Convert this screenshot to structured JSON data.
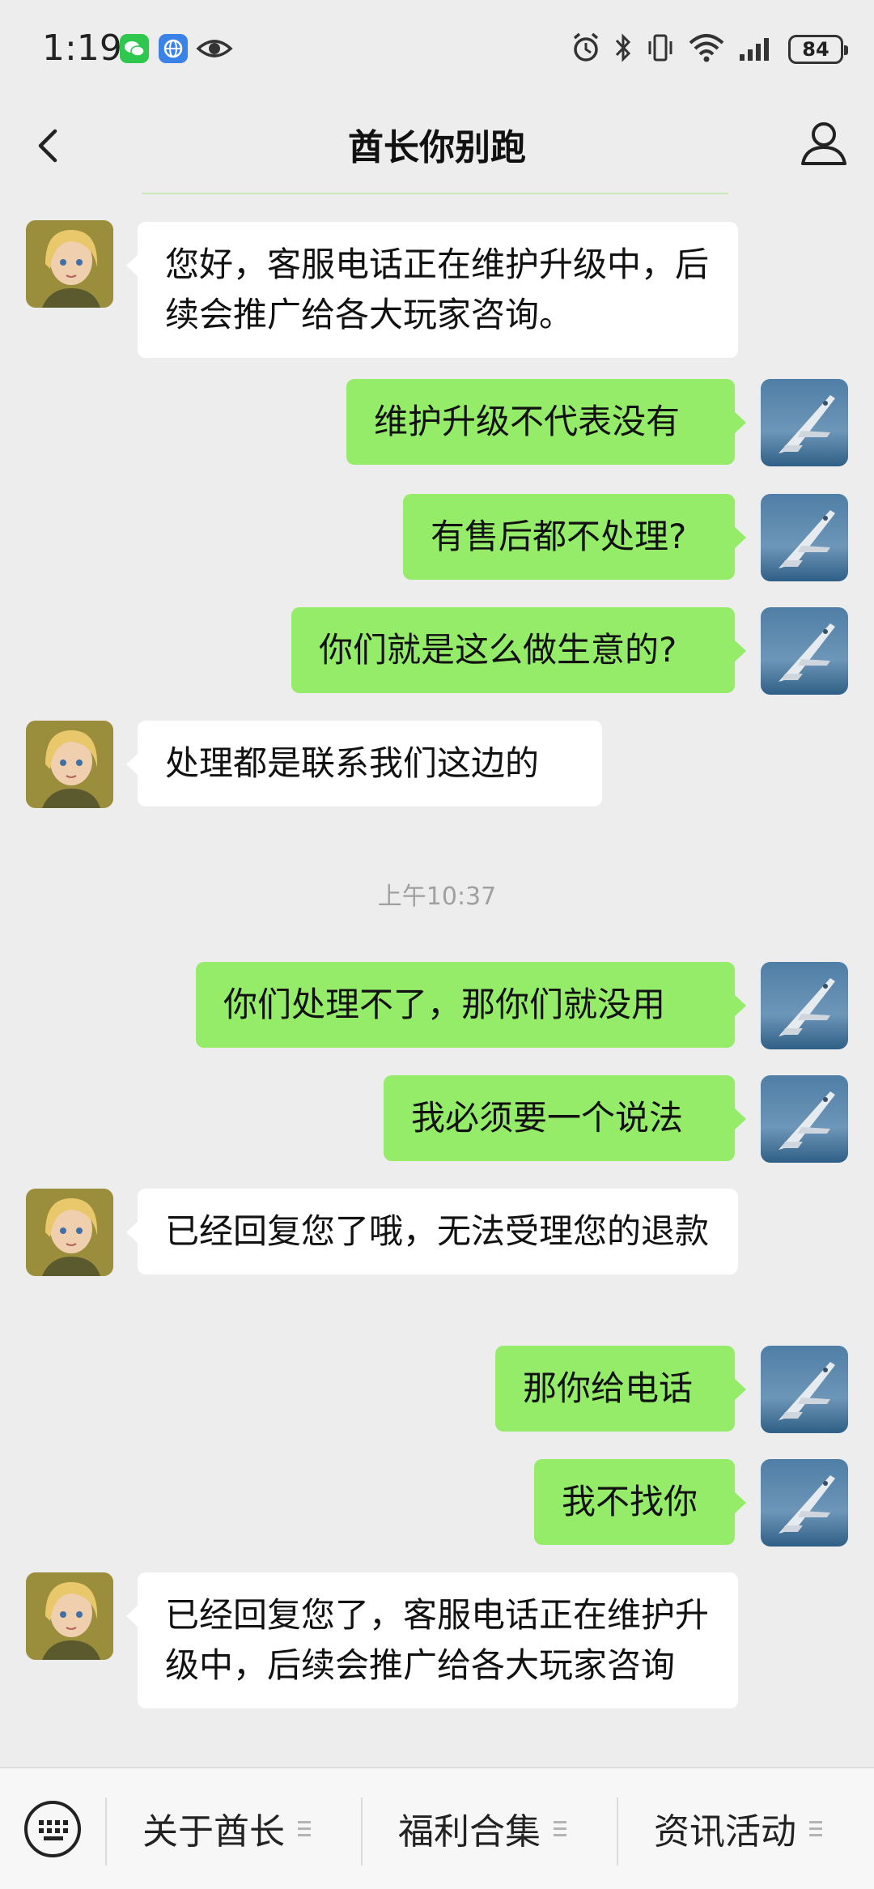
{
  "status_bar": {
    "time": "1:19",
    "battery": "84",
    "left_icons": [
      "wechat-icon",
      "browser-icon",
      "eye-icon"
    ],
    "right_icons": [
      "alarm-icon",
      "bluetooth-icon",
      "vibrate-icon",
      "wifi-icon",
      "signal-icon",
      "battery-icon"
    ]
  },
  "header": {
    "title": "酋长你别跑",
    "back_icon": "chevron-left-icon",
    "profile_icon": "person-icon"
  },
  "messages": [
    {
      "side": "in",
      "text": "您好，客服电话正在维护升级中，后续会推广给各大玩家咨询。"
    },
    {
      "side": "out",
      "text": "维护升级不代表没有"
    },
    {
      "side": "out",
      "text": "有售后都不处理?"
    },
    {
      "side": "out",
      "text": "你们就是这么做生意的?"
    },
    {
      "side": "in",
      "text": "处理都是联系我们这边的"
    },
    {
      "side": "out",
      "text": "你们处理不了，那你们就没用"
    },
    {
      "side": "out",
      "text": "我必须要一个说法"
    },
    {
      "side": "in",
      "text": "已经回复您了哦，无法受理您的退款"
    },
    {
      "side": "out",
      "text": "那你给电话"
    },
    {
      "side": "out",
      "text": "我不找你"
    },
    {
      "side": "in",
      "text": "已经回复您了，客服电话正在维护升级中，后续会推广给各大玩家咨询"
    }
  ],
  "timestamp": "上午10:37",
  "bottom_menu": {
    "keyboard_icon": "keyboard-icon",
    "items": [
      {
        "label": "关于酋长"
      },
      {
        "label": "福利合集"
      },
      {
        "label": "资讯活动"
      }
    ]
  },
  "colors": {
    "background": "#ededed",
    "outgoing_bubble": "#95ec69",
    "incoming_bubble": "#ffffff",
    "timestamp": "#a0a0a0"
  }
}
